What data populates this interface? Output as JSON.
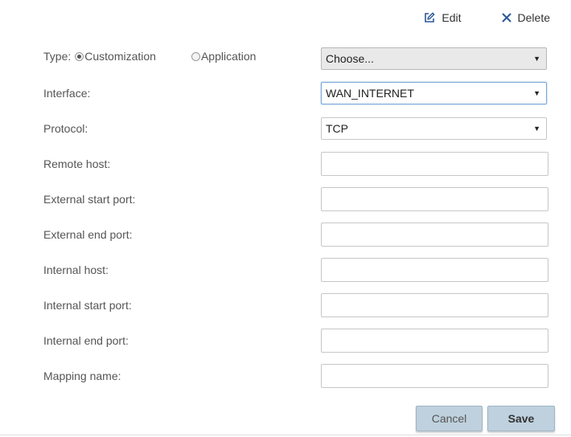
{
  "toolbar": {
    "edit_label": "Edit",
    "delete_label": "Delete",
    "accent_color": "#2b5797"
  },
  "form": {
    "type": {
      "label": "Type:",
      "options": [
        "Customization",
        "Application"
      ],
      "selected": "Customization",
      "application_select": "Choose..."
    },
    "interface": {
      "label": "Interface:",
      "value": "WAN_INTERNET"
    },
    "protocol": {
      "label": "Protocol:",
      "value": "TCP"
    },
    "remote_host": {
      "label": "Remote host:",
      "value": ""
    },
    "external_start_port": {
      "label": "External start port:",
      "value": ""
    },
    "external_end_port": {
      "label": "External end port:",
      "value": ""
    },
    "internal_host": {
      "label": "Internal host:",
      "value": ""
    },
    "internal_start_port": {
      "label": "Internal start port:",
      "value": ""
    },
    "internal_end_port": {
      "label": "Internal end port:",
      "value": ""
    },
    "mapping_name": {
      "label": "Mapping name:",
      "value": ""
    }
  },
  "actions": {
    "cancel_label": "Cancel",
    "save_label": "Save"
  }
}
